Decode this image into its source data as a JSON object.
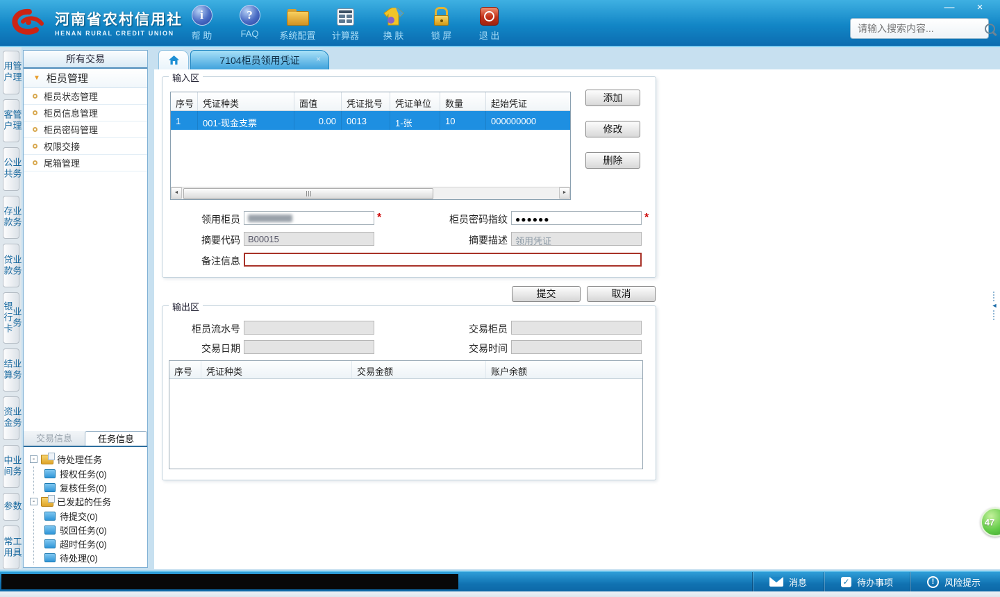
{
  "header": {
    "logo_title": "河南省农村信用社",
    "logo_subtitle": "HENAN RURAL CREDIT UNION",
    "toolbar": [
      {
        "label": "帮 助",
        "glyph": "i"
      },
      {
        "label": "FAQ",
        "glyph": "?"
      },
      {
        "label": "系统配置"
      },
      {
        "label": "计算器"
      },
      {
        "label": "换 肤"
      },
      {
        "label": "锁 屏"
      },
      {
        "label": "退 出"
      }
    ],
    "search_placeholder": "请输入搜索内容...",
    "window": {
      "minimize": "—",
      "close": "×"
    }
  },
  "vertical_tabs": [
    "用户管理",
    "客户管理",
    "公共业务",
    "存款业务",
    "贷款业务",
    "银行卡业务",
    "结算业务",
    "资金业务",
    "中间业务",
    "参数",
    "常用工具"
  ],
  "sidebar": {
    "header": "所有交易",
    "group_label": "柜员管理",
    "items": [
      "柜员状态管理",
      "柜员信息管理",
      "柜员密码管理",
      "权限交接",
      "尾箱管理"
    ],
    "bottom_tabs": [
      {
        "label": "交易信息"
      },
      {
        "label": "任务信息"
      }
    ],
    "task_tree": [
      {
        "label": "待处理任务",
        "children": [
          "授权任务(0)",
          "复核任务(0)"
        ]
      },
      {
        "label": "已发起的任务",
        "children": [
          "待提交(0)",
          "驳回任务(0)",
          "超时任务(0)",
          "待处理(0)"
        ]
      }
    ]
  },
  "tabs": {
    "active_label": "7104柜员领用凭证"
  },
  "input_area": {
    "legend": "输入区",
    "table": {
      "headers": [
        "序号",
        "凭证种类",
        "面值",
        "凭证批号",
        "凭证单位",
        "数量",
        "起始凭证"
      ],
      "row": [
        "1",
        "001-现金支票",
        "0.00",
        "0013",
        "1-张",
        "10",
        "000000000"
      ]
    },
    "buttons": [
      "添加",
      "修改",
      "删除"
    ],
    "fields": {
      "receiving_teller_label": "领用柜员",
      "password_label": "柜员密码指纹",
      "password_value": "●●●●●●",
      "summary_code_label": "摘要代码",
      "summary_code_value": "B00015",
      "summary_desc_label": "摘要描述",
      "summary_desc_value": "领用凭证",
      "remark_label": "备注信息",
      "required_mark": "*"
    },
    "submit_label": "提交",
    "cancel_label": "取消"
  },
  "output_area": {
    "legend": "输出区",
    "fields": [
      "柜员流水号",
      "交易柜员",
      "交易日期",
      "交易时间"
    ],
    "table_headers": [
      "序号",
      "凭证种类",
      "交易金额",
      "账户余额"
    ]
  },
  "statusbar": {
    "items": [
      {
        "label": "消息"
      },
      {
        "label": "待办事项"
      },
      {
        "label": "风险提示"
      }
    ]
  },
  "badge": {
    "value": "47"
  },
  "glyphs": {
    "tab_close": "×",
    "menu_arrow": "▼",
    "collapse_arrow": "◄",
    "expander": "-",
    "scroll_left": "◄",
    "scroll_right": "►",
    "check": "✓",
    "exclaim": "!"
  },
  "colors": {
    "header_blue": "#1286c6",
    "selected_row_blue": "#1e8fe1",
    "required_red": "#cc0000",
    "remark_border_red": "#a83228",
    "badge_green": "#63cb48"
  }
}
